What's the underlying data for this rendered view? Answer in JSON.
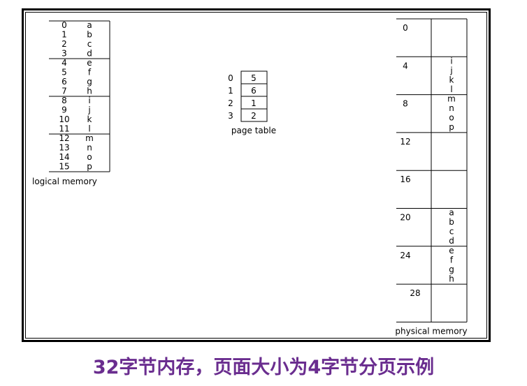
{
  "logical_memory": {
    "label": "logical memory",
    "rows": [
      {
        "index": "0",
        "value": "a"
      },
      {
        "index": "1",
        "value": "b"
      },
      {
        "index": "2",
        "value": "c"
      },
      {
        "index": "3",
        "value": "d"
      },
      {
        "index": "4",
        "value": "e"
      },
      {
        "index": "5",
        "value": "f"
      },
      {
        "index": "6",
        "value": "g"
      },
      {
        "index": "7",
        "value": "h"
      },
      {
        "index": "8",
        "value": "i"
      },
      {
        "index": "9",
        "value": "j"
      },
      {
        "index": "10",
        "value": "k"
      },
      {
        "index": "11",
        "value": "l"
      },
      {
        "index": "12",
        "value": "m"
      },
      {
        "index": "13",
        "value": "n"
      },
      {
        "index": "14",
        "value": "o"
      },
      {
        "index": "15",
        "value": "p"
      }
    ]
  },
  "page_table": {
    "label": "page table",
    "entries": [
      {
        "page": "0",
        "frame": "5"
      },
      {
        "page": "1",
        "frame": "6"
      },
      {
        "page": "2",
        "frame": "1"
      },
      {
        "page": "3",
        "frame": "2"
      }
    ]
  },
  "physical_memory": {
    "label": "physical memory",
    "frames": [
      {
        "address": "0",
        "contents": []
      },
      {
        "address": "4",
        "contents": [
          "i",
          "j",
          "k",
          "l"
        ]
      },
      {
        "address": "8",
        "contents": [
          "m",
          "n",
          "o",
          "p"
        ]
      },
      {
        "address": "12",
        "contents": []
      },
      {
        "address": "16",
        "contents": []
      },
      {
        "address": "20",
        "contents": [
          "a",
          "b",
          "c",
          "d"
        ]
      },
      {
        "address": "24",
        "contents": [
          "e",
          "f",
          "g",
          "h"
        ]
      },
      {
        "address": "28",
        "contents": []
      }
    ]
  },
  "caption": "32字节内存，页面大小为4字节分页示例",
  "colors": {
    "caption": "#6a2d8f",
    "lines": "#000000"
  }
}
